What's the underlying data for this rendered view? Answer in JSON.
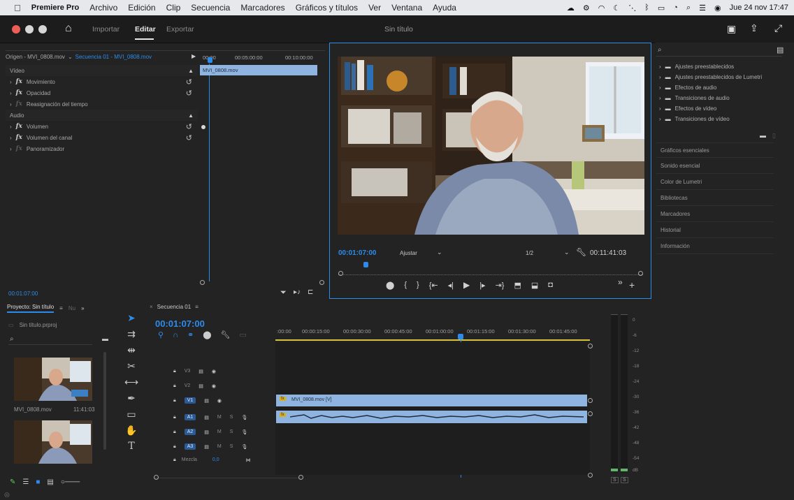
{
  "menubar": {
    "apple": "",
    "app_name": "Premiere Pro",
    "items": [
      "Archivo",
      "Edición",
      "Clip",
      "Secuencia",
      "Marcadores",
      "Gráficos y títulos",
      "Ver",
      "Ventana",
      "Ayuda"
    ],
    "clock": "Jue 24 nov  17:47"
  },
  "app_header": {
    "tabs": [
      "Importar",
      "Editar",
      "Exportar"
    ],
    "active_tab": "Editar",
    "title": "Sin título"
  },
  "effect_controls": {
    "header_origin": "Origen - MVI_0808.mov",
    "header_sequence": "Secuencia 01 - MVI_0808.mov",
    "sections": {
      "video": "Vídeo",
      "audio": "Audio"
    },
    "video_effects": [
      "Movimiento",
      "Opacidad",
      "Reasignación del tiempo"
    ],
    "audio_effects": [
      "Volumen",
      "Volumen del canal",
      "Panoramizador"
    ],
    "mini_ruler": [
      "00:00",
      "00:05:00:00",
      "00:10:00:00"
    ],
    "clip_label": "MVI_0808.mov",
    "timecode": "00:01:07:00"
  },
  "program_monitor": {
    "timecode": "00:01:07:00",
    "fit_label": "Ajustar",
    "resolution": "1/2",
    "duration": "00:11:41:03"
  },
  "right_panel": {
    "effects": [
      "Ajustes preestablecidos",
      "Ajustes preestablecidos de Lumetri",
      "Efectos de audio",
      "Transiciones de audio",
      "Efectos de vídeo",
      "Transiciones de vídeo"
    ],
    "panels": [
      "Gráficos esenciales",
      "Sonido esencial",
      "Color de Lumetri",
      "Bibliotecas",
      "Marcadores",
      "Historial",
      "Información"
    ]
  },
  "project": {
    "tab_label": "Proyecto: Sin título",
    "tab_menu": "≡",
    "tab_other": "Nu",
    "file_name": "Sin título.prproj",
    "clip_name": "MVI_0808.mov",
    "clip_duration": "11:41:03"
  },
  "timeline": {
    "tab_label": "Secuencia 01",
    "tab_menu": "≡",
    "timecode": "00:01:07:00",
    "ruler": [
      ":00:00",
      "00:00:15:00",
      "00:00:30:00",
      "00:00:45:00",
      "00:01:00:00",
      "00:01:15:00",
      "00:01:30:00",
      "00:01:45:00"
    ],
    "tracks_video": [
      "V3",
      "V2",
      "V1"
    ],
    "tracks_audio": [
      "A1",
      "A2",
      "A3"
    ],
    "mix_label": "Mezcla",
    "mix_value": "0,0",
    "video_clip_label": "MVI_0808.mov [V]",
    "audio_ms": [
      "M",
      "S"
    ]
  },
  "meter": {
    "labels": [
      "0",
      "-6",
      "-12",
      "-18",
      "-24",
      "-30",
      "-36",
      "-42",
      "-48",
      "-54",
      "dB"
    ],
    "solo": [
      "S",
      "S"
    ]
  },
  "colors": {
    "accent": "#2d8ceb",
    "panel_bg": "#232323",
    "clip_blue": "#8fb4e0",
    "playhead": "#2d8ceb"
  }
}
